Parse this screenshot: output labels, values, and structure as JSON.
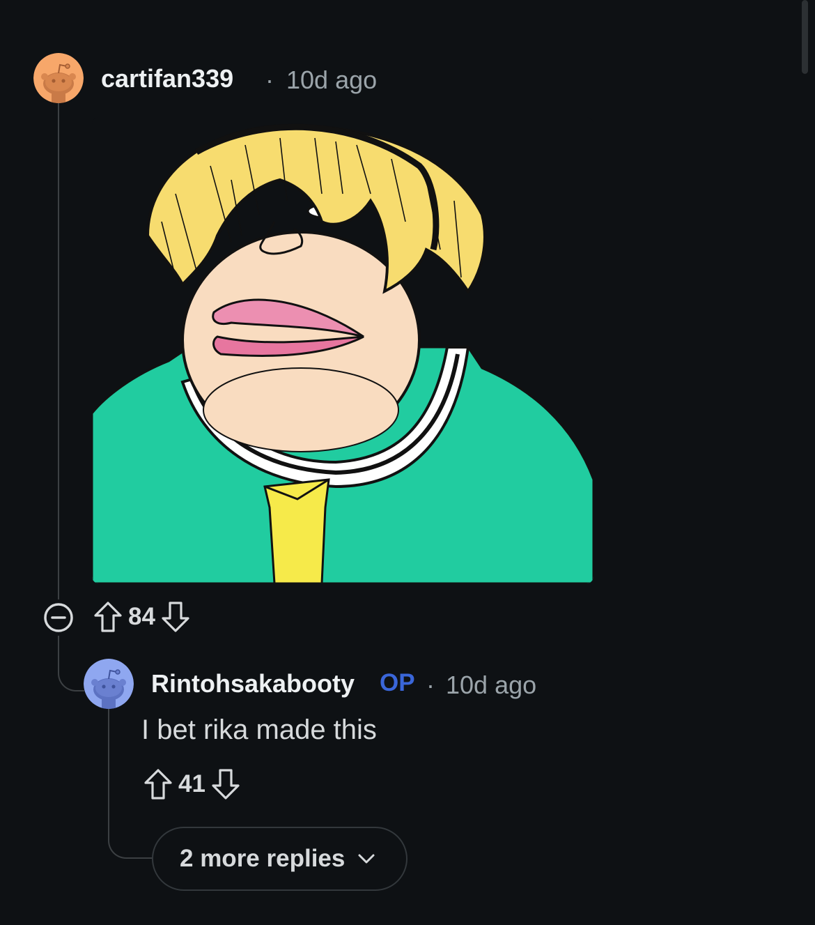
{
  "comments": [
    {
      "username": "cartifan339",
      "separator": "·",
      "time": "10d ago",
      "votes": "84",
      "avatar_color": "#f7a76a",
      "attachment": "image"
    },
    {
      "username": "Rintohsakabooty",
      "op_badge": "OP",
      "separator": "·",
      "time": "10d ago",
      "body": "I bet rika made this",
      "votes": "41",
      "avatar_color": "#8fa7f0"
    }
  ],
  "more_replies": {
    "label": "2 more replies"
  },
  "icons": {
    "upvote": "upvote-arrow-icon",
    "downvote": "downvote-arrow-icon",
    "collapse": "minus-circle-icon",
    "expand": "chevron-down-icon"
  },
  "colors": {
    "background": "#0e1114",
    "op_accent": "#3a66d9",
    "meme_shirt": "#21cca0",
    "meme_hair": "#f7dc6f"
  }
}
